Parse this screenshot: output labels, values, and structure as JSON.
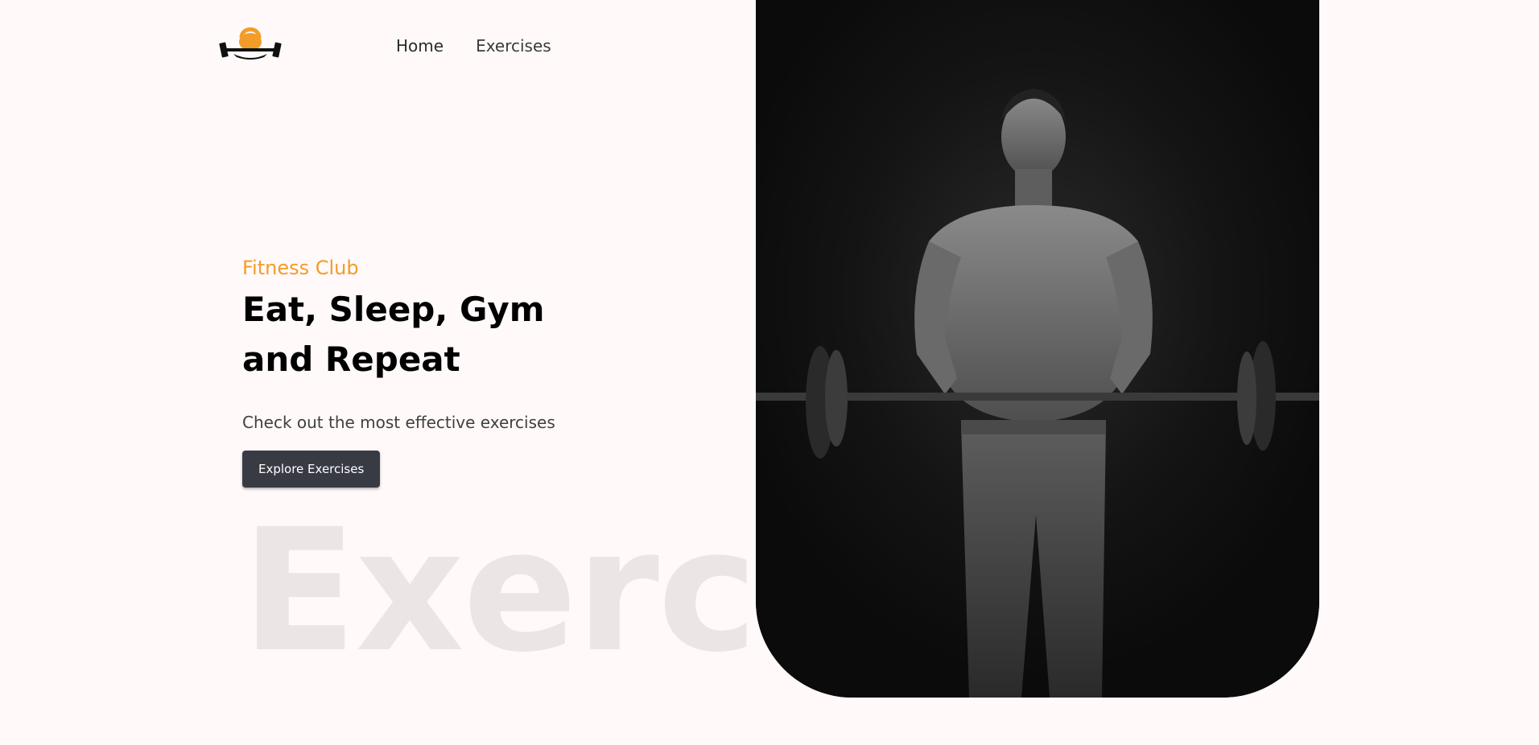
{
  "nav": {
    "links": [
      {
        "label": "Home"
      },
      {
        "label": "Exercises"
      }
    ]
  },
  "hero": {
    "tag": "Fitness Club",
    "title_line1": "Eat, Sleep, Gym",
    "title_line2": "and Repeat",
    "subtitle": "Check out the most effective exercises",
    "button_label": "Explore Exercises",
    "background_word": "Exercise"
  },
  "colors": {
    "accent": "#f39c28",
    "page_background": "#fff9f9",
    "button_background": "#393b44",
    "banner_background": "#0d0d0d"
  },
  "icons": {
    "logo": "kettlebell-dumbbell-logo"
  }
}
